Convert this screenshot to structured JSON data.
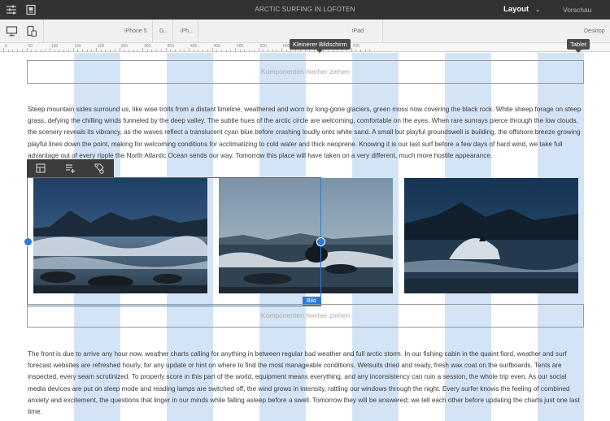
{
  "topbar": {
    "title": "ARCTIC SURFING IN LOFOTEN",
    "layout_label": "Layout",
    "layout_chevron": "⌄",
    "preview_label": "Vorschau",
    "icons": [
      "sliders-icon",
      "page-icon"
    ]
  },
  "devicebar": {
    "labels": {
      "iphone5": "iPhone 5",
      "galaxy": "G..",
      "iphone": "iPh...",
      "ipad": "iPad",
      "desktop": "Desktop"
    },
    "icons": [
      "desktop-monitor-icon",
      "mobile-device-icon"
    ]
  },
  "ruler": {
    "labels": [
      "0",
      "50",
      "100",
      "150",
      "200",
      "250",
      "300",
      "350",
      "400",
      "450",
      "500",
      "550",
      "600",
      "650",
      "700",
      "750"
    ]
  },
  "tooltips": {
    "smaller_screen": "Kleinerer Bildschirm",
    "tablet": "Tablet"
  },
  "placeholders": {
    "top": "Komponenten hierher ziehen",
    "bottom": "Komponenten hierher ziehen"
  },
  "text": {
    "para1": "Steep mountain sides surround us, like wise trolls from a distant timeline, weathered and worn by long-gone glaciers, green moss now covering the black rock. White sheep forage on steep grass, defying the chilling winds funneled by the deep valley. The subtle hues of the arctic circle are welcoming, comfortable on the eyes. When rare sunrays pierce through the low clouds, the scenery reveals its vibrancy, as the waves reflect a translucent cyan blue before crashing loudly onto white sand. A small but playful groundswell is building, the offshore breeze growing playful lines down the point, making for welcoming conditions for acclimatizing to cold water and thick neoprene. Knowing it is our last surf before a few days of hard wind, we take full advantage out of every ripple the North Atlantic Ocean sends our way. Tomorrow this place will have taken on a very different, much more hostile appearance.",
    "para2": "The front is due to arrive any hour now, weather charts calling for anything in between regular bad weather and full arctic storm. In our fishing cabin in the quaint fiord, weather and surf forecast websites are refreshed hourly, for any update or hint on where to find the most manageable conditions. Wetsuits dried and ready, fresh wax coat on the surfboards. Tents are inspected, every seam scrutinized. To properly score in this part of the world, equipment means everything, and any inconsistency can ruin a session, the whole trip even. As our social media devices are put on sleep mode and reading lamps are switched off, the wind grows in intensity, rattling our windows through the night. Every surfer knows the feeling of combined anxiety and excitement, the questions that linger in our minds while falling asleep before a swell. Tomorrow they will be answered; we tell each other before updating the charts just one last time."
  },
  "selection": {
    "badge": "Bild"
  },
  "component_toolbar": {
    "icons": [
      "layout-grid-icon",
      "stack-add-icon",
      "tag-settings-icon"
    ]
  },
  "colors": {
    "topbar_bg": "#323232",
    "accent_blue": "#2d7ad6",
    "grid_column": "#b0cef0"
  }
}
